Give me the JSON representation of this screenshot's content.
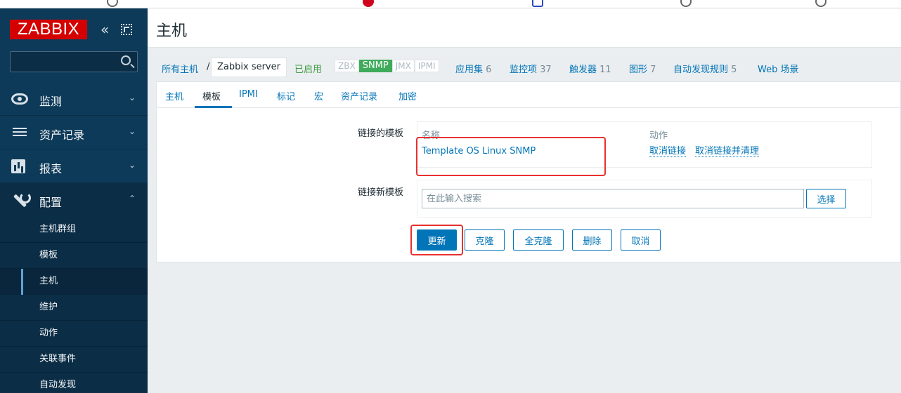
{
  "sidebar": {
    "logo": "ZABBIX",
    "search_value": "",
    "menu": [
      {
        "label": "监测",
        "icon": "eye-icon"
      },
      {
        "label": "资产记录",
        "icon": "list-icon"
      },
      {
        "label": "报表",
        "icon": "bar-chart-icon"
      },
      {
        "label": "配置",
        "icon": "wrench-icon"
      }
    ],
    "submenu": [
      "主机群组",
      "模板",
      "主机",
      "维护",
      "动作",
      "关联事件",
      "自动发现"
    ],
    "selected_submenu": "主机"
  },
  "header": {
    "title": "主机"
  },
  "host_bar": {
    "all_hosts": "所有主机",
    "separator": "/",
    "current_host": "Zabbix server",
    "status": "已启用",
    "availability": [
      "ZBX",
      "SNMP",
      "JMX",
      "IPMI"
    ],
    "active_availability": "SNMP",
    "links": [
      {
        "label": "应用集",
        "count": "6"
      },
      {
        "label": "监控项",
        "count": "37"
      },
      {
        "label": "触发器",
        "count": "11"
      },
      {
        "label": "图形",
        "count": "7"
      },
      {
        "label": "自动发现规则",
        "count": "5"
      },
      {
        "label": "Web 场景",
        "count": ""
      }
    ]
  },
  "tabs": [
    "主机",
    "模板",
    "IPMI",
    "标记",
    "宏",
    "资产记录",
    "加密"
  ],
  "active_tab": "模板",
  "form": {
    "linked_label": "链接的模板",
    "col_name": "名称",
    "col_action": "动作",
    "linked_template": "Template OS Linux SNMP",
    "unlink": "取消链接",
    "unlink_clear": "取消链接并清理",
    "new_label": "链接新模板",
    "search_placeholder": "在此输入搜索",
    "select_button": "选择"
  },
  "buttons": {
    "update": "更新",
    "clone": "克隆",
    "full_clone": "全克隆",
    "delete": "删除",
    "cancel": "取消"
  },
  "highlight_color": "#e8312f"
}
